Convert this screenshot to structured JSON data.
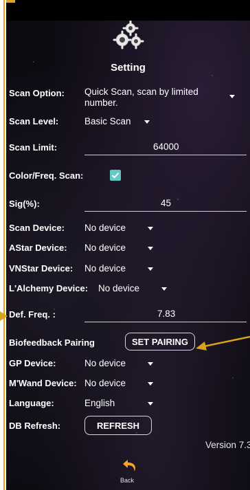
{
  "header": {
    "title": "Setting",
    "icon": "gears-icon"
  },
  "settings": {
    "scan_option": {
      "label": "Scan Option:",
      "value": "Quick Scan, scan by limited number."
    },
    "scan_level": {
      "label": "Scan Level:",
      "value": "Basic Scan"
    },
    "scan_limit": {
      "label": "Scan Limit:",
      "value": "64000"
    },
    "color_freq_scan": {
      "label": "Color/Freq. Scan:",
      "checked": true
    },
    "sig": {
      "label": "Sig(%):",
      "value": "45"
    },
    "scan_device": {
      "label": "Scan Device:",
      "value": "No device"
    },
    "astar_device": {
      "label": "AStar Device:",
      "value": "No device"
    },
    "vnstar_device": {
      "label": "VNStar Device:",
      "value": "No device"
    },
    "lalchemy_device": {
      "label": "L'Alchemy Device:",
      "value": "No device"
    },
    "def_freq": {
      "label": "Def. Freq. :",
      "value": "7.83"
    },
    "biofeedback": {
      "label": "Biofeedback Pairing",
      "button": "SET PAIRING"
    },
    "gp_device": {
      "label": "GP Device:",
      "value": "No device"
    },
    "mwand_device": {
      "label": "M'Wand Device:",
      "value": "No device"
    },
    "language": {
      "label": "Language:",
      "value": "English"
    },
    "db_refresh": {
      "label": "DB Refresh:",
      "button": "REFRESH"
    }
  },
  "footer": {
    "version": "Version 7.3",
    "back_label": "Back",
    "back_icon": "back-arrow-icon"
  },
  "colors": {
    "accent": "#64c8c4",
    "annotation": "#d9a21b",
    "background": "#0d0b12"
  }
}
